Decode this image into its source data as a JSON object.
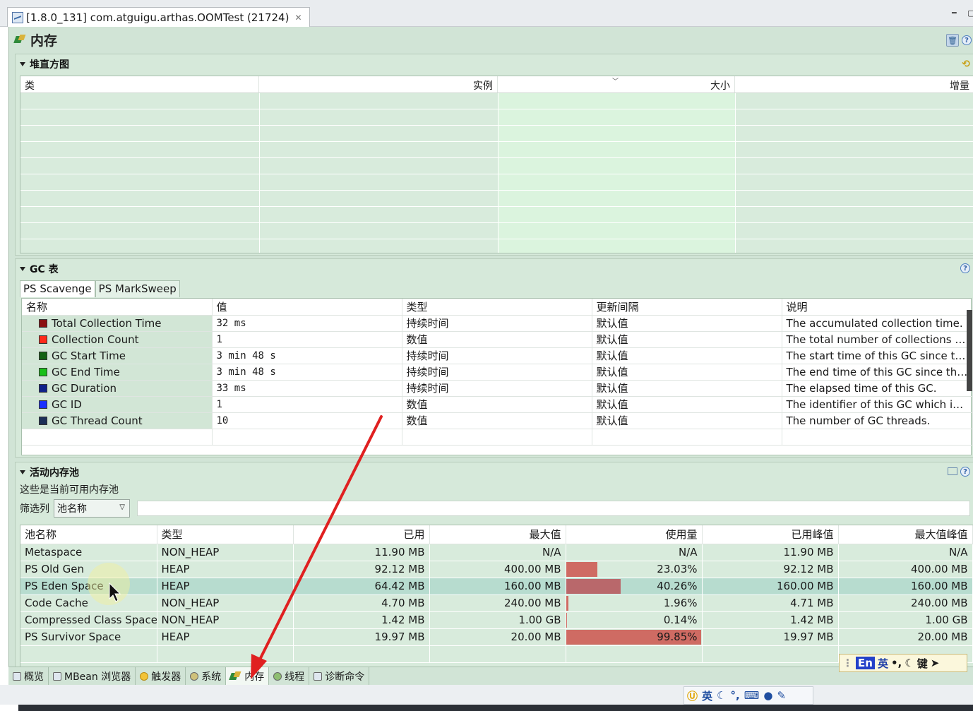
{
  "editor_tab": {
    "title": "[1.8.0_131] com.atguigu.arthas.OOMTest (21724)",
    "close": "✕"
  },
  "view": {
    "title": "内存"
  },
  "histogram": {
    "header": "堆直方图",
    "columns": [
      "类",
      "实例",
      "大小",
      "增量"
    ]
  },
  "gc": {
    "header": "GC 表",
    "tabs": [
      "PS Scavenge",
      "PS MarkSweep"
    ],
    "columns": [
      "名称",
      "值",
      "类型",
      "更新间隔",
      "说明"
    ],
    "rows": [
      {
        "name": "Total Collection Time",
        "color": "#8b1010",
        "value": "32 ms",
        "type": "持续时间",
        "interval": "默认值",
        "desc": "The accumulated collection time."
      },
      {
        "name": "Collection Count",
        "color": "#ff2a1a",
        "value": "1",
        "type": "数值",
        "interval": "默认值",
        "desc": "The total number of collections th..."
      },
      {
        "name": "GC Start Time",
        "color": "#146214",
        "value": "3 min 48 s",
        "type": "持续时间",
        "interval": "默认值",
        "desc": "The start time of this GC since the ..."
      },
      {
        "name": "GC End Time",
        "color": "#18c018",
        "value": "3 min 48 s",
        "type": "持续时间",
        "interval": "默认值",
        "desc": "The end time of this GC since the J..."
      },
      {
        "name": "GC Duration",
        "color": "#10218a",
        "value": "33 ms",
        "type": "持续时间",
        "interval": "默认值",
        "desc": "The elapsed time of this GC."
      },
      {
        "name": "GC ID",
        "color": "#1a2fff",
        "value": "1",
        "type": "数值",
        "interval": "默认值",
        "desc": "The identifier of this GC which is t..."
      },
      {
        "name": "GC Thread Count",
        "color": "#1c2f58",
        "value": "10",
        "type": "数值",
        "interval": "默认值",
        "desc": "The number of GC threads."
      }
    ]
  },
  "pools": {
    "header": "活动内存池",
    "description": "这些是当前可用内存池",
    "filter_label": "筛选列",
    "filter_value": "池名称",
    "columns": [
      "池名称",
      "类型",
      "已用",
      "最大值",
      "使用量",
      "已用峰值",
      "最大值峰值"
    ],
    "rows": [
      {
        "name": "Metaspace",
        "type": "NON_HEAP",
        "used": "11.90 MB",
        "max": "N/A",
        "usage": "N/A",
        "usage_frac": 0,
        "peak": "11.90 MB",
        "peak_max": "N/A"
      },
      {
        "name": "PS Old Gen",
        "type": "HEAP",
        "used": "92.12 MB",
        "max": "400.00 MB",
        "usage": "23.03%",
        "usage_frac": 0.2303,
        "peak": "92.12 MB",
        "peak_max": "400.00 MB"
      },
      {
        "name": "PS Eden Space",
        "type": "HEAP",
        "used": "64.42 MB",
        "max": "160.00 MB",
        "usage": "40.26%",
        "usage_frac": 0.4026,
        "peak": "160.00 MB",
        "peak_max": "160.00 MB"
      },
      {
        "name": "Code Cache",
        "type": "NON_HEAP",
        "used": "4.70 MB",
        "max": "240.00 MB",
        "usage": "1.96%",
        "usage_frac": 0.0196,
        "peak": "4.71 MB",
        "peak_max": "240.00 MB"
      },
      {
        "name": "Compressed Class Space",
        "type": "NON_HEAP",
        "used": "1.42 MB",
        "max": "1.00 GB",
        "usage": "0.14%",
        "usage_frac": 0.0014,
        "peak": "1.42 MB",
        "peak_max": "1.00 GB"
      },
      {
        "name": "PS Survivor Space",
        "type": "HEAP",
        "used": "19.97 MB",
        "max": "20.00 MB",
        "usage": "99.85%",
        "usage_frac": 0.9985,
        "peak": "19.97 MB",
        "peak_max": "20.00 MB"
      }
    ]
  },
  "bottom_tabs": [
    "概览",
    "MBean 浏览器",
    "触发器",
    "系统",
    "内存",
    "线程",
    "诊断命令"
  ],
  "ime_status": {
    "mode": "英"
  },
  "ime_float": {
    "en": "En",
    "mode": "英",
    "punct": "•,",
    "key": "键"
  },
  "colors": {
    "usage_bar": "#cf6b63",
    "selected_row": "#b7dccf",
    "panel_bg": "#d1e4d6"
  }
}
